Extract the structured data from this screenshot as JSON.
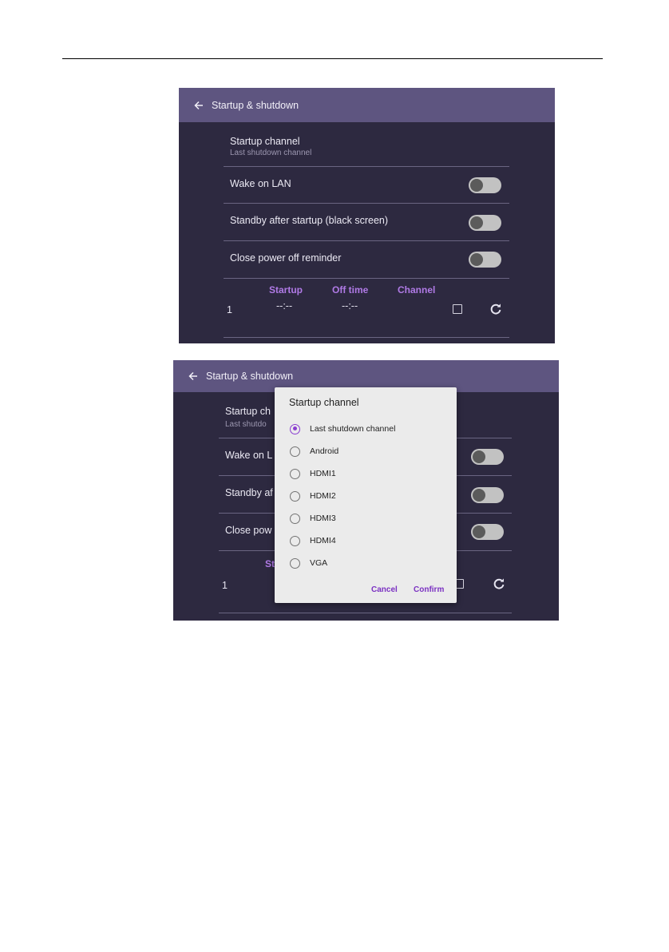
{
  "colors": {
    "screen_bg": "#2d2940",
    "appbar_bg": "#5e5580",
    "accent_purple": "#b07ae6",
    "dialog_bg": "#ebebeb",
    "dialog_accent": "#8a3ed0"
  },
  "screen1": {
    "appbar": {
      "back_icon": "arrow-left-icon",
      "title": "Startup & shutdown"
    },
    "startup_channel": {
      "title": "Startup channel",
      "subtitle": "Last shutdown channel"
    },
    "wake_on_lan": {
      "title": "Wake on LAN",
      "enabled": false
    },
    "standby_after_startup": {
      "title": "Standby after startup (black screen)",
      "enabled": false
    },
    "close_power_off_reminder": {
      "title": "Close power off reminder",
      "enabled": false
    },
    "schedule": {
      "headers": [
        "Startup",
        "Off time",
        "Channel"
      ],
      "rows": [
        {
          "index": "1",
          "startup": "--:--",
          "off_time": "--:--",
          "checked": false,
          "refresh_icon": "refresh-icon"
        }
      ]
    }
  },
  "screen2": {
    "appbar": {
      "back_icon": "arrow-left-icon",
      "title": "Startup & shutdown"
    },
    "background_rows": {
      "startup_channel_title": "Startup ch",
      "startup_channel_subtitle": "Last shutdo",
      "wake_on_lan": "Wake on L",
      "standby": "Standby af",
      "close_power": "Close pow",
      "schedule_header_partial": "St",
      "schedule_index": "1"
    },
    "dialog": {
      "title": "Startup channel",
      "options": [
        "Last shutdown channel",
        "Android",
        "HDMI1",
        "HDMI2",
        "HDMI3",
        "HDMI4",
        "VGA"
      ],
      "selected": "Last shutdown channel",
      "cancel_label": "Cancel",
      "confirm_label": "Confirm"
    }
  }
}
